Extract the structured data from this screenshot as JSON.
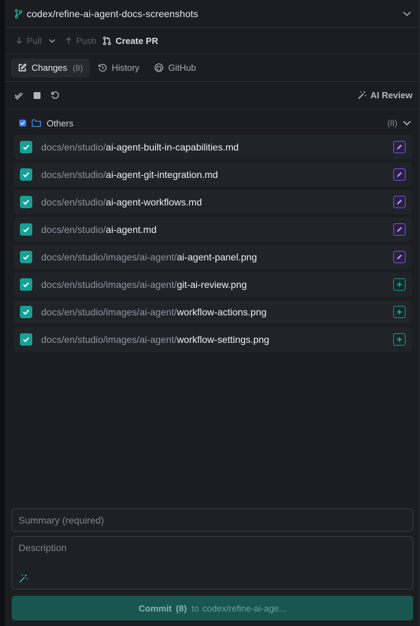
{
  "branch": {
    "name": "codex/refine-ai-agent-docs-screenshots"
  },
  "toolbar": {
    "pull_label": "Pull",
    "push_label": "Push",
    "create_pr_label": "Create PR"
  },
  "tabs": [
    {
      "label": "Changes",
      "count": "(8)",
      "active": true
    },
    {
      "label": "History"
    },
    {
      "label": "GitHub"
    }
  ],
  "actions": {
    "ai_review_label": "AI Review"
  },
  "group": {
    "label": "Others",
    "count": "(8)"
  },
  "files": [
    {
      "dir": "docs/en/studio/",
      "name": "ai-agent-built-in-capabilities.md",
      "status": "modified"
    },
    {
      "dir": "docs/en/studio/",
      "name": "ai-agent-git-integration.md",
      "status": "modified"
    },
    {
      "dir": "docs/en/studio/",
      "name": "ai-agent-workflows.md",
      "status": "modified"
    },
    {
      "dir": "docs/en/studio/",
      "name": "ai-agent.md",
      "status": "modified"
    },
    {
      "dir": "docs/en/studio/images/ai-agent/",
      "name": "ai-agent-panel.png",
      "status": "modified"
    },
    {
      "dir": "docs/en/studio/images/ai-agent/",
      "name": "git-ai-review.png",
      "status": "added"
    },
    {
      "dir": "docs/en/studio/images/ai-agent/",
      "name": "workflow-actions.png",
      "status": "added"
    },
    {
      "dir": "docs/en/studio/images/ai-agent/",
      "name": "workflow-settings.png",
      "status": "added"
    }
  ],
  "commit": {
    "summary_placeholder": "Summary (required)",
    "description_placeholder": "Description",
    "button_label": "Commit",
    "button_count": "(8)",
    "button_to": "to",
    "button_target": "codex/refine-ai-age..."
  },
  "colors": {
    "accent_teal": "#15a196",
    "modified_purple": "#7b52e8",
    "checkbox_blue": "#3d7cf0",
    "background": "#1b1d21"
  },
  "icons": {
    "branch": "git-branch-icon",
    "chevron": "chevron-down-icon",
    "pull": "arrow-down-icon",
    "push": "arrow-up-icon",
    "pr": "pull-request-icon",
    "changes": "edit-icon",
    "history": "history-icon",
    "github": "github-icon",
    "check_all": "double-check-icon",
    "stop": "stop-icon",
    "discard": "undo-icon",
    "ai": "magic-wand-icon",
    "folder": "folder-icon",
    "modified": "pencil-icon",
    "added": "plus-icon"
  }
}
